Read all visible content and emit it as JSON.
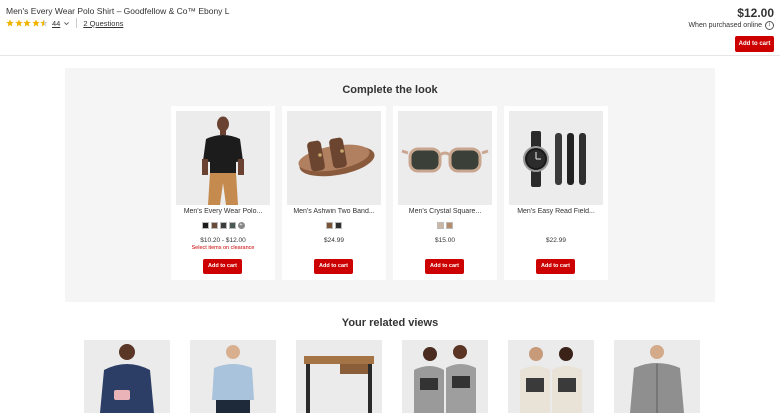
{
  "header": {
    "product_title": "Men's Every Wear Polo Shirt – Goodfellow & Co™ Ebony L",
    "rating_value": 4.5,
    "rating_count": "44",
    "questions": "2 Questions",
    "price": "$12.00",
    "purchased_note": "When purchased online",
    "add_to_cart": "Add to cart"
  },
  "complete_the_look": {
    "title": "Complete the look",
    "items": [
      {
        "name": "Men's Every Wear Polo...",
        "price": "$10.20 - $12.00",
        "clearance": "Select items on clearance",
        "swatches": [
          "#1b1b1b",
          "#6b4a3a",
          "#3c3c3c",
          "#4a5a52"
        ],
        "more_swatches": true,
        "add_to_cart": "Add to cart"
      },
      {
        "name": "Men's Ashwin Two Band...",
        "price": "$24.99",
        "swatches": [
          "#7a5438",
          "#2f2f2f"
        ],
        "add_to_cart": "Add to cart"
      },
      {
        "name": "Men's Crystal Square...",
        "price": "$15.00",
        "swatches": [
          "#cbb7a6",
          "#b48c6e"
        ],
        "add_to_cart": "Add to cart"
      },
      {
        "name": "Men's Easy Read Field...",
        "price": "$22.99",
        "add_to_cart": "Add to cart"
      }
    ]
  },
  "related_views": {
    "title": "Your related views"
  },
  "colors": {
    "accent": "#cc0000",
    "star": "#f0b400",
    "panel": "#f5f5f5"
  }
}
